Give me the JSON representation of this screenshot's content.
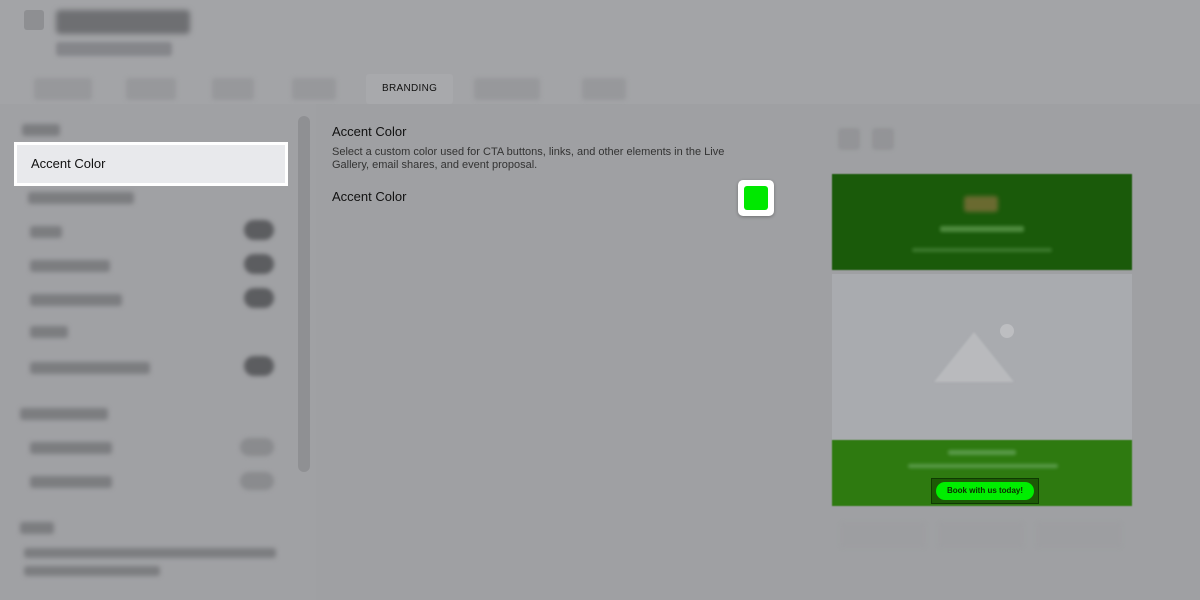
{
  "tabs": {
    "active_label": "BRANDING"
  },
  "sidebar": {
    "highlighted_item": "Accent Color"
  },
  "main": {
    "section_title": "Accent Color",
    "section_description": "Select a custom color used for CTA buttons, links, and other elements in the Live Gallery, email shares, and event proposal.",
    "field_label": "Accent Color",
    "swatch_color": "#00e800"
  },
  "preview": {
    "cta_label": "Book with us today!",
    "hero_color": "#1a5a0a",
    "footer_color": "#2e7a10",
    "cta_color": "#00ee00"
  }
}
